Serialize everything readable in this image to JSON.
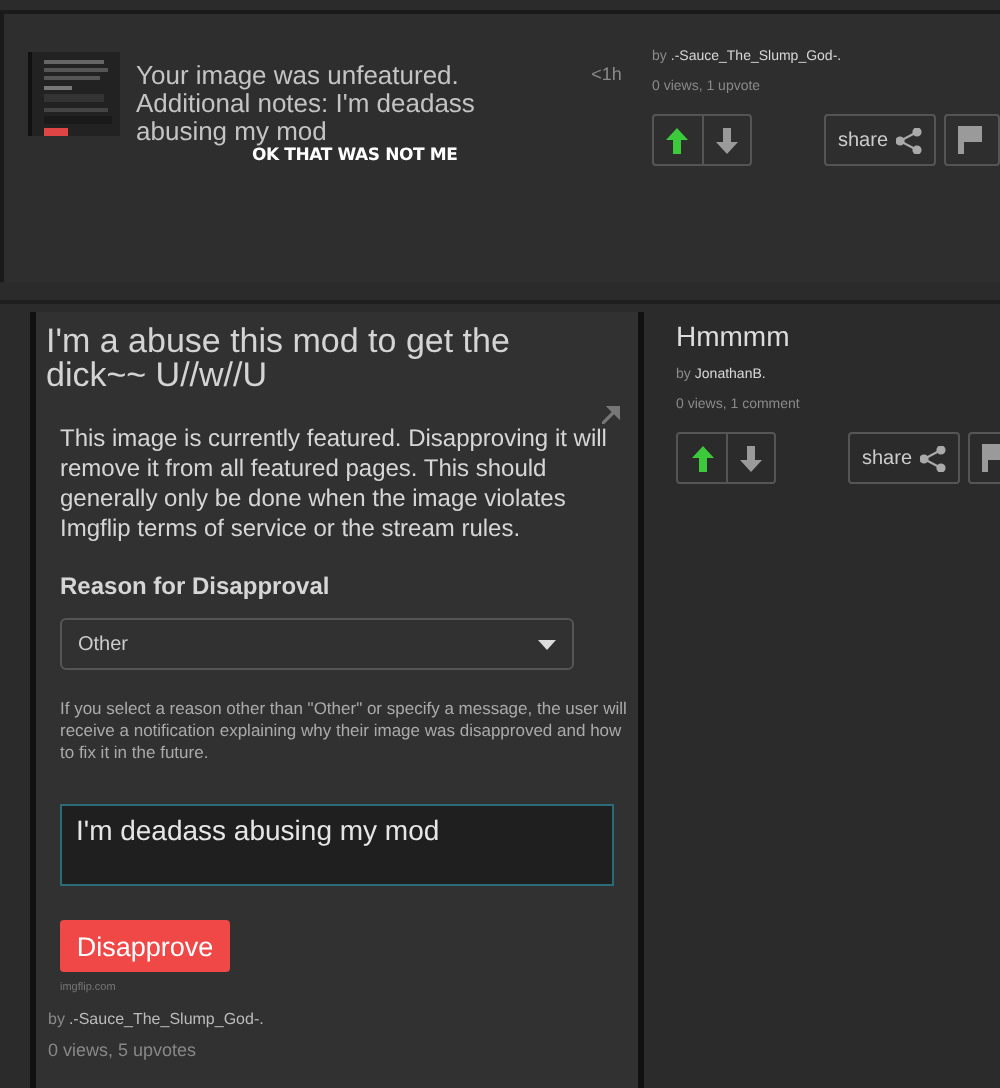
{
  "notification": {
    "message": "Your image was unfeatured. Additional notes: I'm deadass abusing my mod",
    "caption": "OK THAT WAS NOT ME",
    "time": "<1h",
    "author_prefix": "by",
    "author": ".-Sauce_The_Slump_God-.",
    "stats": "0 views, 1 upvote",
    "upvote": {
      "selected": true
    },
    "downvote": {
      "selected": false
    },
    "share": "share"
  },
  "featured_post": {
    "title": "I'm a abuse this mod to get the dick~~ U//w//U",
    "notice": "This image is currently featured. Disapproving it will remove it from all featured pages. This should generally only be done when the image violates Imgflip terms of service or the stream rules.",
    "reason_label": "Reason for Disapproval",
    "reason_select": {
      "value": "Other"
    },
    "helper": "If you select a reason other than \"Other\" or specify a message, the user will receive a notification explaining why their image was disapproved and how to fix it in the future.",
    "message_field": {
      "value": "I'm deadass abusing my mod"
    },
    "button": "Disapprove",
    "source": "imgflip.com",
    "author_prefix": "by",
    "author": ".-Sauce_The_Slump_God-.",
    "stats": "0 views, 5 upvotes"
  },
  "side_post": {
    "title": "Hmmmm",
    "author_prefix": "by",
    "author": "JonathanB.",
    "stats": "0 views, 1 comment",
    "upvote": {
      "selected": true
    },
    "downvote": {
      "selected": false
    },
    "share": "share"
  }
}
